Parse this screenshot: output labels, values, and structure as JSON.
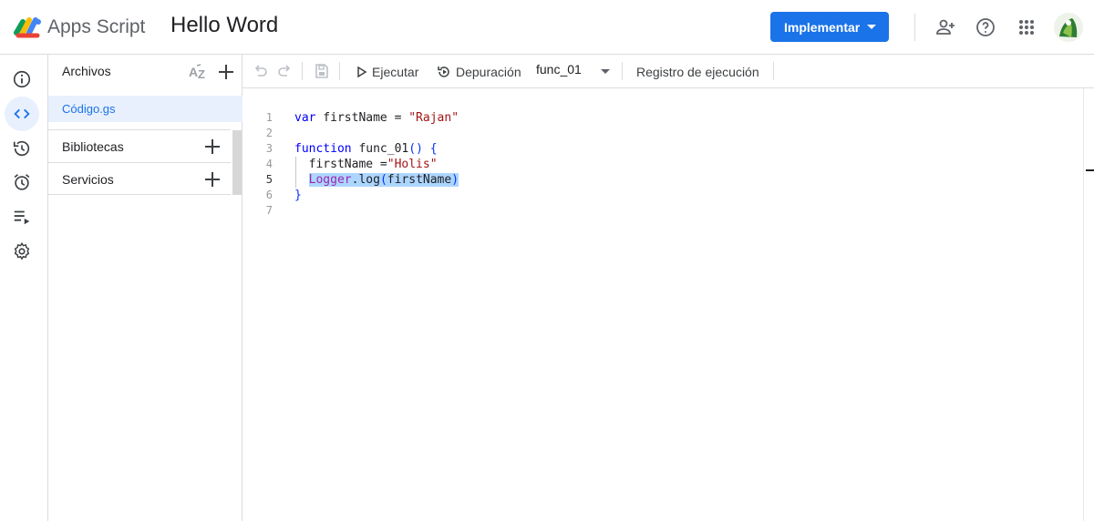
{
  "header": {
    "app_name": "Apps Script",
    "project_title": "Hello Word",
    "deploy_label": "Implementar",
    "icons": [
      "add-person-icon",
      "help-icon",
      "apps-grid-icon",
      "account-avatar"
    ]
  },
  "rail": {
    "items": [
      "info-icon",
      "code-icon",
      "history-icon",
      "alarm-icon",
      "executions-icon",
      "settings-icon"
    ],
    "active": "code-icon"
  },
  "files_panel": {
    "title": "Archivos",
    "files": [
      {
        "name": "Código.gs"
      }
    ],
    "sections": [
      {
        "label": "Bibliotecas"
      },
      {
        "label": "Servicios"
      }
    ]
  },
  "toolbar": {
    "run_label": "Ejecutar",
    "debug_label": "Depuración",
    "function_selected": "func_01",
    "log_label": "Registro de ejecución"
  },
  "editor": {
    "current_line": 5,
    "line_numbers": [
      "1",
      "2",
      "3",
      "4",
      "5",
      "6",
      "7"
    ],
    "lines": [
      [
        {
          "t": "var",
          "c": "kw"
        },
        {
          "t": " firstName = ",
          "c": ""
        },
        {
          "t": "\"Rajan\"",
          "c": "str"
        }
      ],
      [],
      [
        {
          "t": "function",
          "c": "kw"
        },
        {
          "t": " func_01",
          "c": ""
        },
        {
          "t": "()",
          "c": "brk"
        },
        {
          "t": " ",
          "c": ""
        },
        {
          "t": "{",
          "c": "brk"
        }
      ],
      [
        {
          "t": "  firstName =",
          "c": ""
        },
        {
          "t": "\"Holis\"",
          "c": "str"
        }
      ],
      [
        {
          "t": "  ",
          "c": ""
        },
        {
          "t": "Logger",
          "c": "cls hl"
        },
        {
          "t": ".log",
          "c": "hl"
        },
        {
          "t": "(",
          "c": "brk hl"
        },
        {
          "t": "firstName",
          "c": "hl"
        },
        {
          "t": ")",
          "c": "brk hl"
        }
      ],
      [
        {
          "t": "}",
          "c": "brk"
        }
      ],
      []
    ]
  },
  "colors": {
    "accent": "#1a73e8",
    "active_bg": "#e8f0fe",
    "keyword": "#0000ff",
    "string": "#a31515",
    "selection": "#add6ff"
  }
}
